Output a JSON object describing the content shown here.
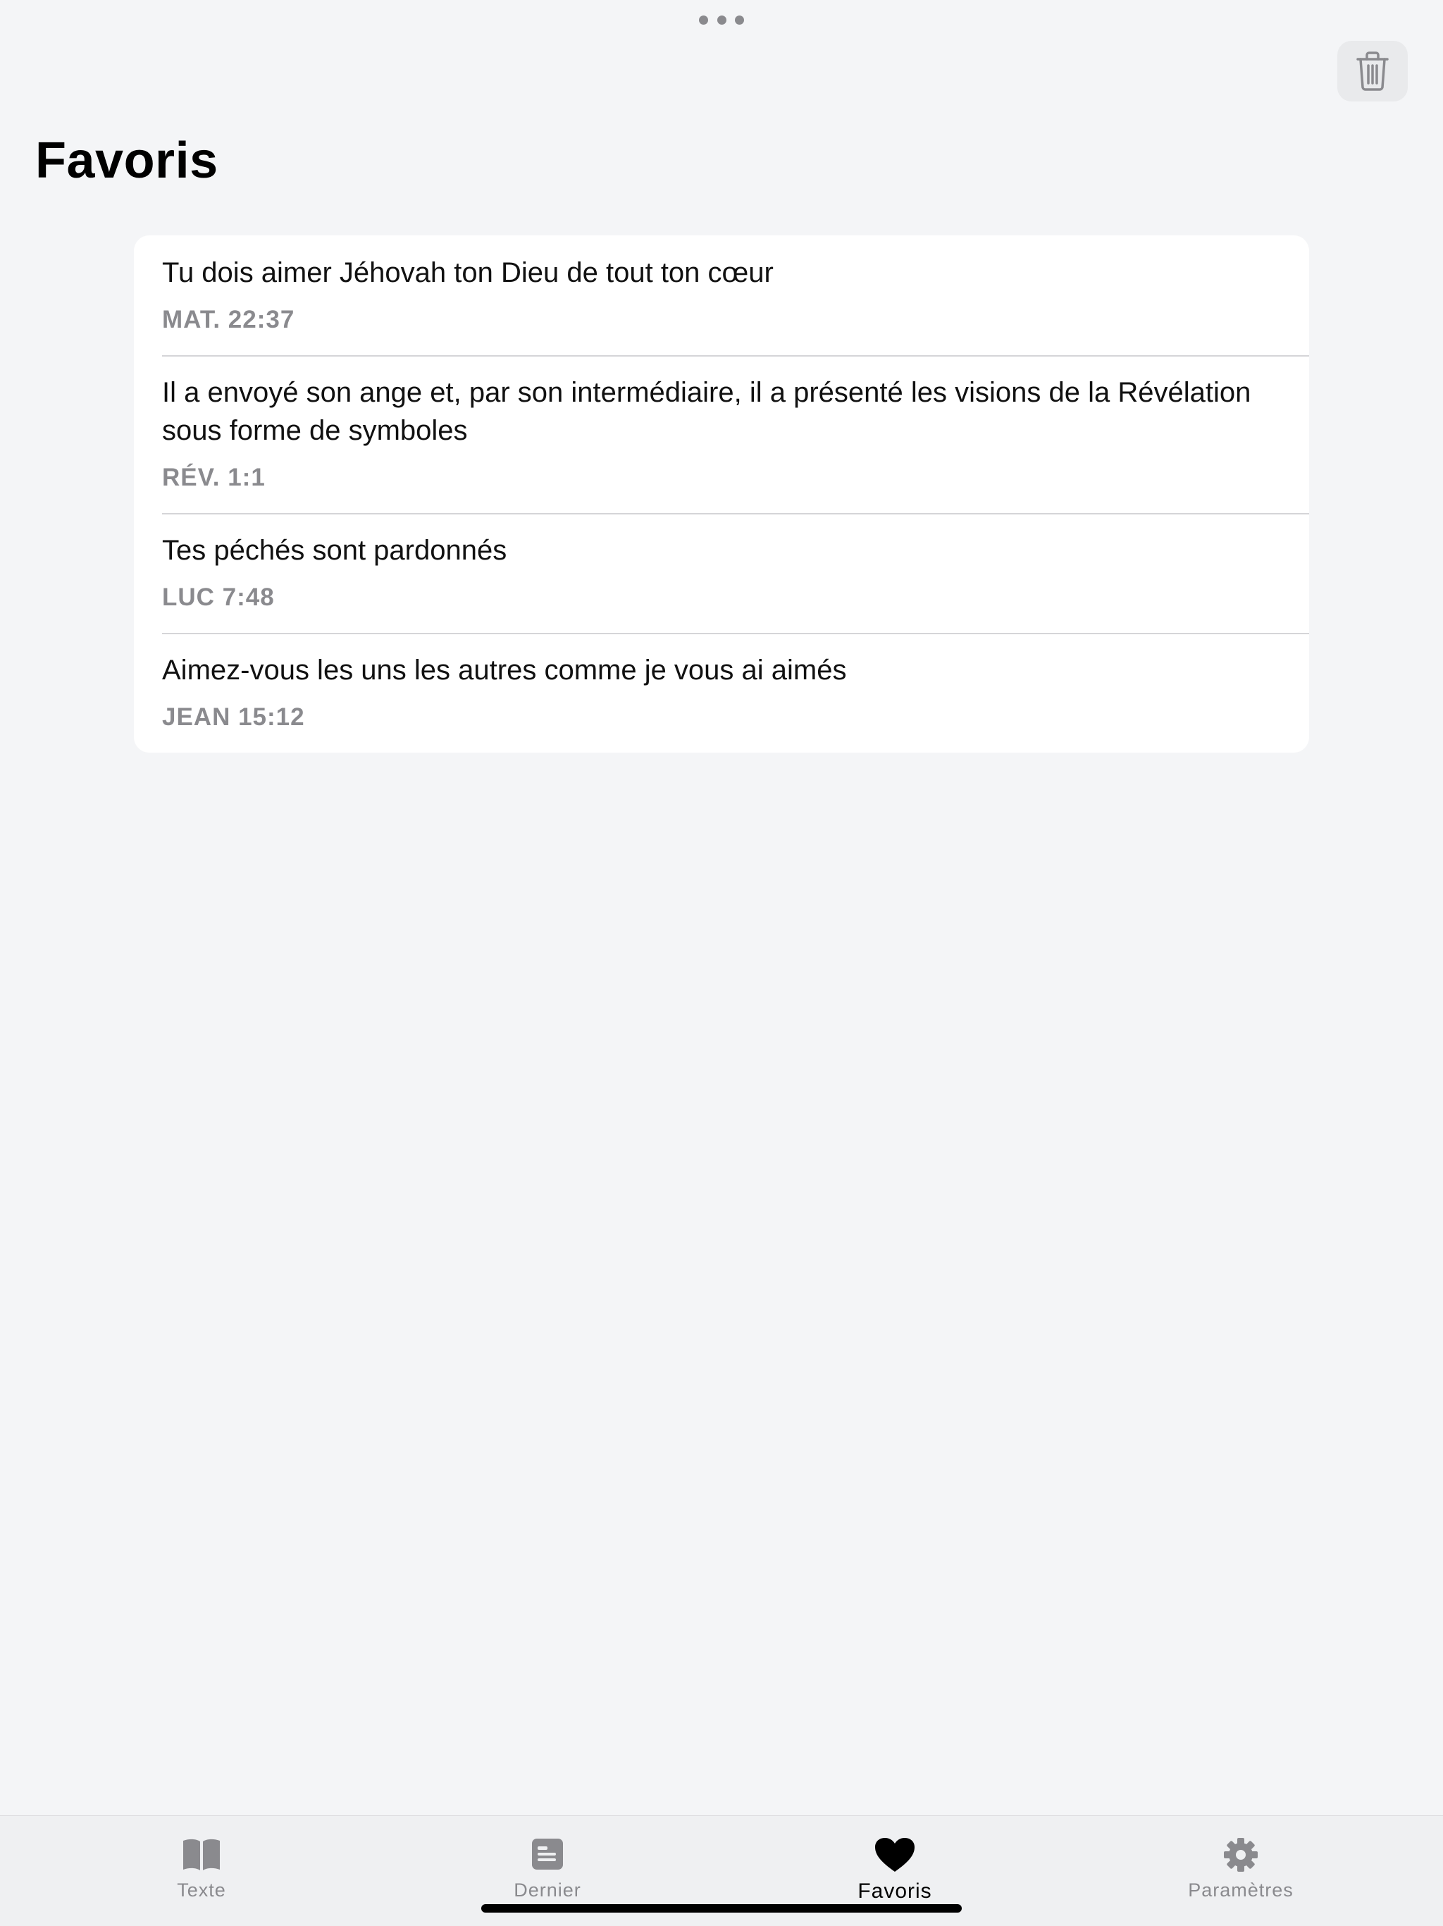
{
  "header": {
    "title": "Favoris"
  },
  "favorites": [
    {
      "text": "Tu dois aimer Jéhovah ton Dieu de tout ton cœur",
      "reference": "MAT. 22:37"
    },
    {
      "text": "Il a envoyé son ange et, par son intermédiaire, il a présenté les visions de la Révélation sous forme de symboles",
      "reference": "RÉV. 1:1"
    },
    {
      "text": "Tes péchés sont pardonnés",
      "reference": "LUC 7:48"
    },
    {
      "text": "Aimez-vous les uns les autres comme je vous ai aimés",
      "reference": "JEAN 15:12"
    }
  ],
  "tab_bar": {
    "tabs": [
      {
        "label": "Texte",
        "icon": "book-icon",
        "active": false
      },
      {
        "label": "Dernier",
        "icon": "document-icon",
        "active": false
      },
      {
        "label": "Favoris",
        "icon": "heart-icon",
        "active": true
      },
      {
        "label": "Paramètres",
        "icon": "gear-icon",
        "active": false
      }
    ]
  },
  "colors": {
    "background": "#f4f5f7",
    "card": "#ffffff",
    "secondary_text": "#8a8a8e",
    "active_tab": "#000000",
    "inactive_tab": "#8a8a8e"
  }
}
